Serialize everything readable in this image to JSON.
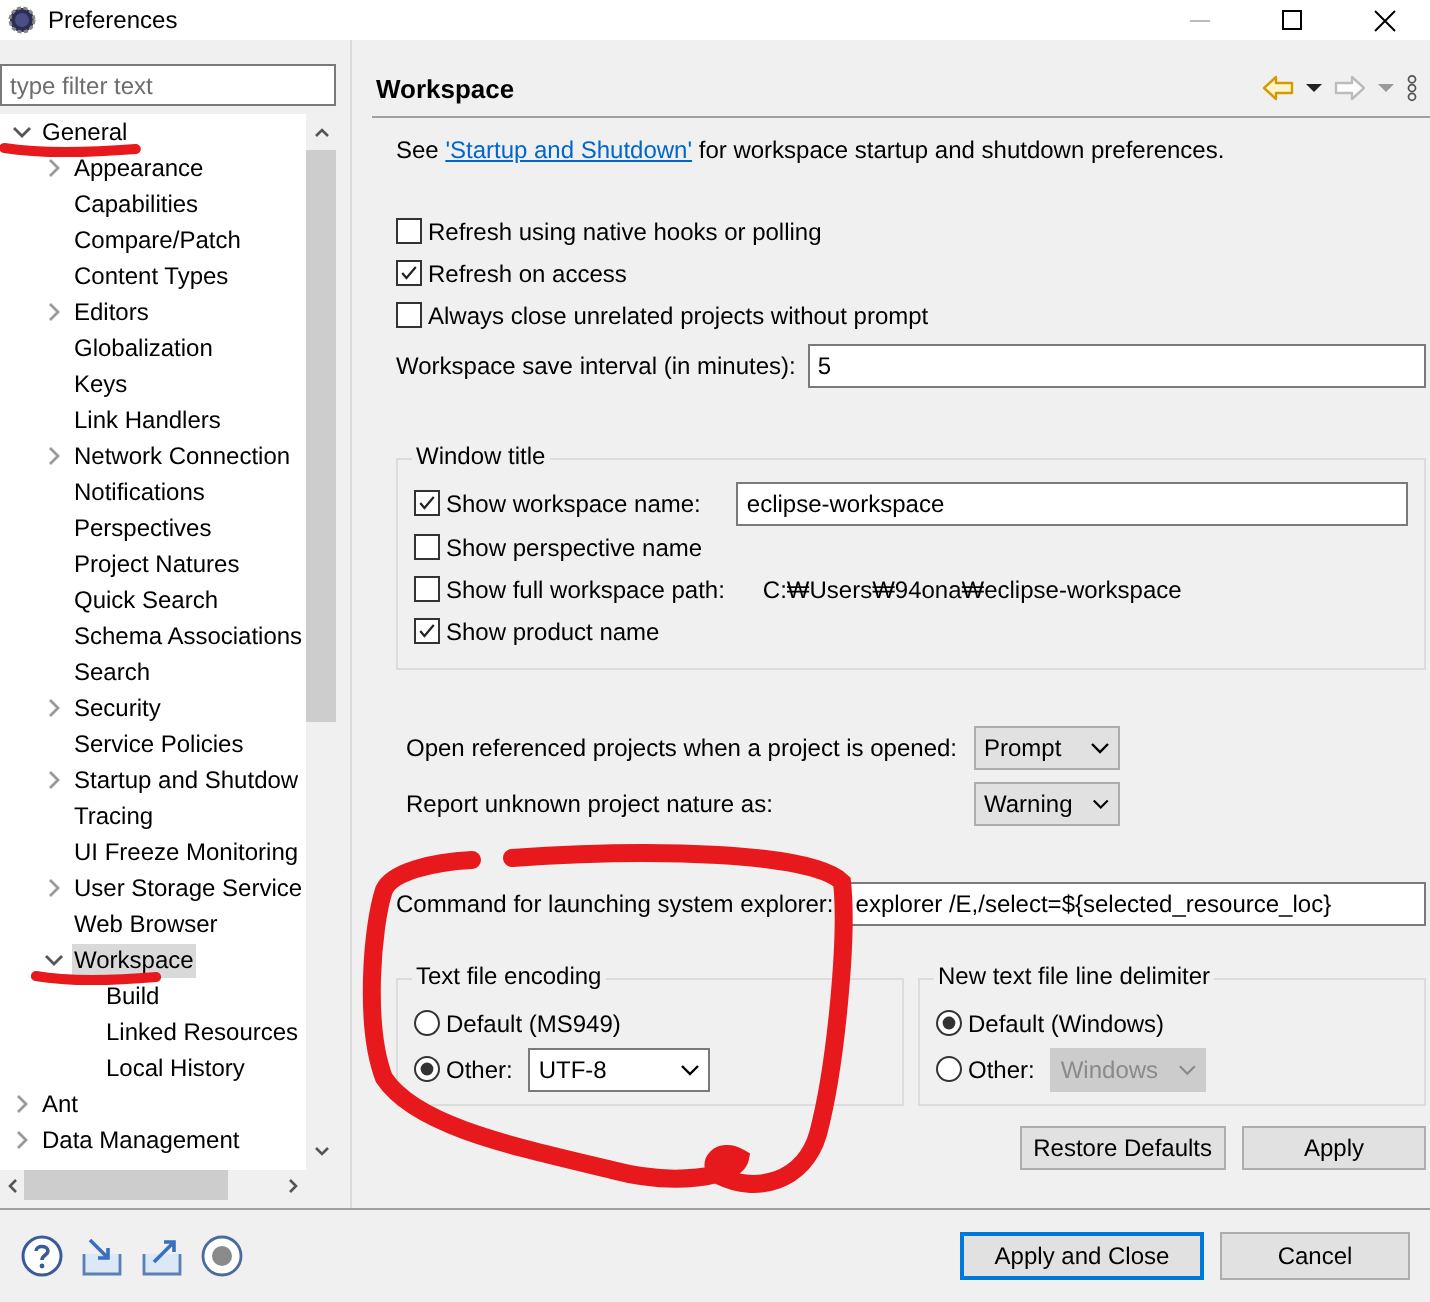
{
  "window": {
    "title": "Preferences"
  },
  "filter": {
    "placeholder": "type filter text"
  },
  "tree": [
    {
      "label": "General",
      "expanded": true,
      "selected": false,
      "marked": true,
      "children": [
        {
          "label": "Appearance",
          "expanded": false,
          "selected": false,
          "marked": false
        },
        {
          "label": "Capabilities",
          "selected": false,
          "marked": false
        },
        {
          "label": "Compare/Patch",
          "selected": false,
          "marked": false
        },
        {
          "label": "Content Types",
          "selected": false,
          "marked": false
        },
        {
          "label": "Editors",
          "expanded": false,
          "selected": false,
          "marked": false
        },
        {
          "label": "Globalization",
          "selected": false,
          "marked": false
        },
        {
          "label": "Keys",
          "selected": false,
          "marked": false
        },
        {
          "label": "Link Handlers",
          "selected": false,
          "marked": false
        },
        {
          "label": "Network Connection",
          "expanded": false,
          "selected": false,
          "marked": false
        },
        {
          "label": "Notifications",
          "selected": false,
          "marked": false
        },
        {
          "label": "Perspectives",
          "selected": false,
          "marked": false
        },
        {
          "label": "Project Natures",
          "selected": false,
          "marked": false
        },
        {
          "label": "Quick Search",
          "selected": false,
          "marked": false
        },
        {
          "label": "Schema Associations",
          "selected": false,
          "marked": false
        },
        {
          "label": "Search",
          "selected": false,
          "marked": false
        },
        {
          "label": "Security",
          "expanded": false,
          "selected": false,
          "marked": false
        },
        {
          "label": "Service Policies",
          "selected": false,
          "marked": false
        },
        {
          "label": "Startup and Shutdow",
          "expanded": false,
          "selected": false,
          "marked": false
        },
        {
          "label": "Tracing",
          "selected": false,
          "marked": false
        },
        {
          "label": "UI Freeze Monitoring",
          "selected": false,
          "marked": false
        },
        {
          "label": "User Storage Service",
          "expanded": false,
          "selected": false,
          "marked": false
        },
        {
          "label": "Web Browser",
          "selected": false,
          "marked": false
        },
        {
          "label": "Workspace",
          "expanded": true,
          "selected": true,
          "marked": true,
          "children": [
            {
              "label": "Build",
              "selected": false,
              "marked": false
            },
            {
              "label": "Linked Resources",
              "selected": false,
              "marked": false
            },
            {
              "label": "Local History",
              "selected": false,
              "marked": false
            }
          ]
        }
      ]
    },
    {
      "label": "Ant",
      "expanded": false,
      "selected": false,
      "marked": false
    },
    {
      "label": "Data Management",
      "expanded": false,
      "selected": false,
      "marked": false
    }
  ],
  "page": {
    "title": "Workspace",
    "intro_prefix": "See ",
    "intro_link": "'Startup and Shutdown'",
    "intro_suffix": " for workspace startup and shutdown preferences."
  },
  "options": [
    {
      "label": "Refresh using native hooks or polling",
      "checked": false
    },
    {
      "label": "Refresh on access",
      "checked": true
    },
    {
      "label": "Always close unrelated projects without prompt",
      "checked": false
    }
  ],
  "save_interval": {
    "label": "Workspace save interval (in minutes):",
    "value": "5"
  },
  "window_title_group": {
    "title": "Window title",
    "rows": [
      {
        "kind": "field",
        "label": "Show workspace name:",
        "checked": true,
        "value": "eclipse-workspace"
      },
      {
        "kind": "plain",
        "label": "Show perspective name",
        "checked": false
      },
      {
        "kind": "text",
        "label": "Show full workspace path:",
        "checked": false,
        "value": "C:₩Users₩94ona₩eclipse-workspace"
      },
      {
        "kind": "plain",
        "label": "Show product name",
        "checked": true
      }
    ]
  },
  "combos": [
    {
      "label": "Open referenced projects when a project is opened:",
      "value": "Prompt"
    },
    {
      "label": "Report unknown project nature as:",
      "value": "Warning"
    }
  ],
  "explorer_command": {
    "label": "Command for launching system explorer:",
    "value": "explorer /E,/select=${selected_resource_loc}"
  },
  "encoding_group": {
    "title": "Text file encoding",
    "circled": true,
    "options": [
      {
        "kind": "plain",
        "label": "Default (MS949)",
        "selected": false
      },
      {
        "kind": "combo",
        "label": "Other:",
        "selected": true,
        "value": "UTF-8",
        "disabled": false
      }
    ]
  },
  "delimiter_group": {
    "title": "New text file line delimiter",
    "options": [
      {
        "kind": "plain",
        "label": "Default (Windows)",
        "selected": true
      },
      {
        "kind": "combo",
        "label": "Other:",
        "selected": false,
        "value": "Windows",
        "disabled": true
      }
    ]
  },
  "page_buttons": [
    "Restore Defaults",
    "Apply"
  ],
  "dialog_buttons": [
    {
      "label": "Apply and Close",
      "default": true
    },
    {
      "label": "Cancel",
      "default": false
    }
  ]
}
